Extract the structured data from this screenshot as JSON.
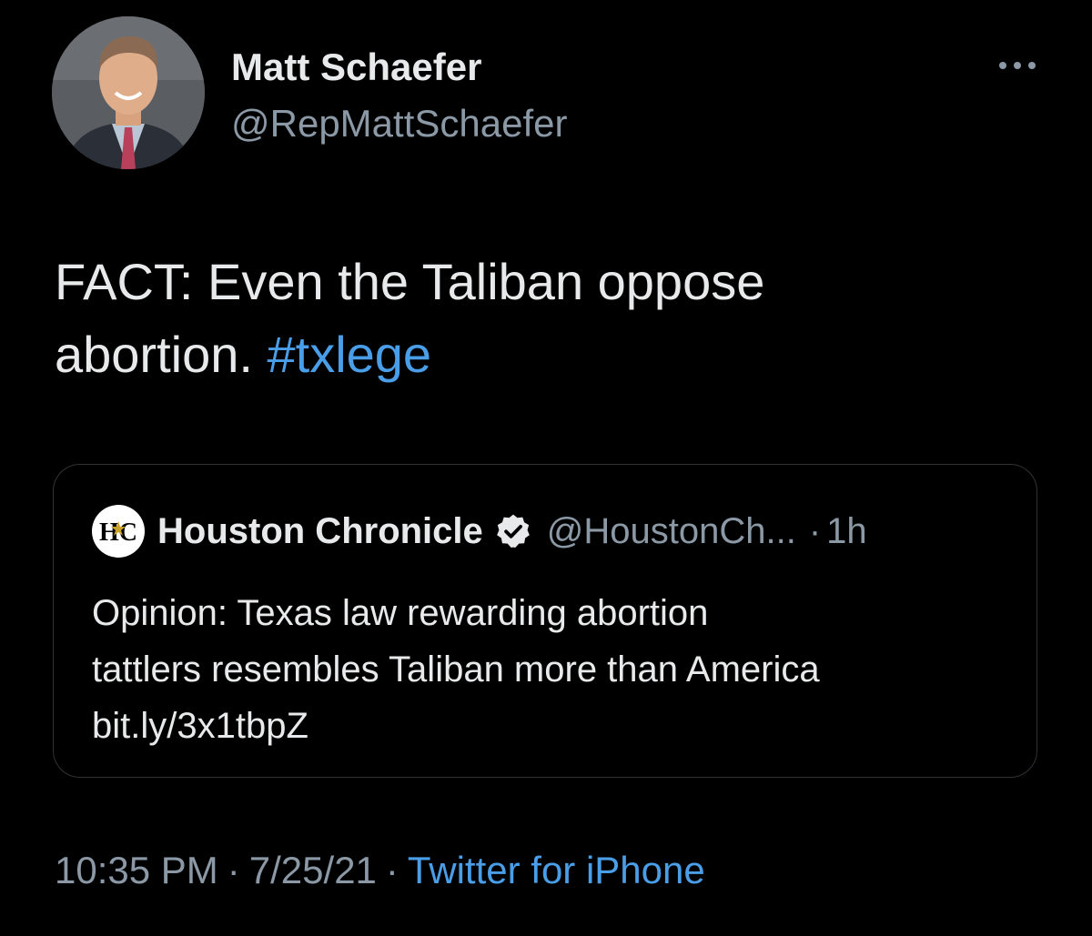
{
  "author": {
    "name": "Matt Schaefer",
    "handle": "@RepMattSchaefer"
  },
  "tweet": {
    "text_main": "FACT:  Even the Taliban oppose",
    "text_line2": "abortion.",
    "hashtag": "#txlege"
  },
  "quoted_tweet": {
    "name": "Houston Chronicle",
    "logo_text": "HC",
    "handle": "@HoustonCh...",
    "separator": "·",
    "time": "1h",
    "line1": "Opinion: Texas law rewarding abortion",
    "line2": "tattlers resembles Taliban more than America",
    "line3": "bit.ly/3x1tbpZ"
  },
  "footer": {
    "time": "10:35 PM",
    "sep1": "·",
    "date": "7/25/21",
    "sep2": "·",
    "source": "Twitter for iPhone"
  },
  "icons": {
    "more": "more-dots-icon",
    "verified": "verified-badge-icon",
    "logo": "houston-chronicle-logo"
  },
  "colors": {
    "background": "#000000",
    "primary_text": "#e7e9ea",
    "secondary_text": "#8b98a5",
    "link": "#4a9ee8",
    "border": "#2f3336"
  }
}
